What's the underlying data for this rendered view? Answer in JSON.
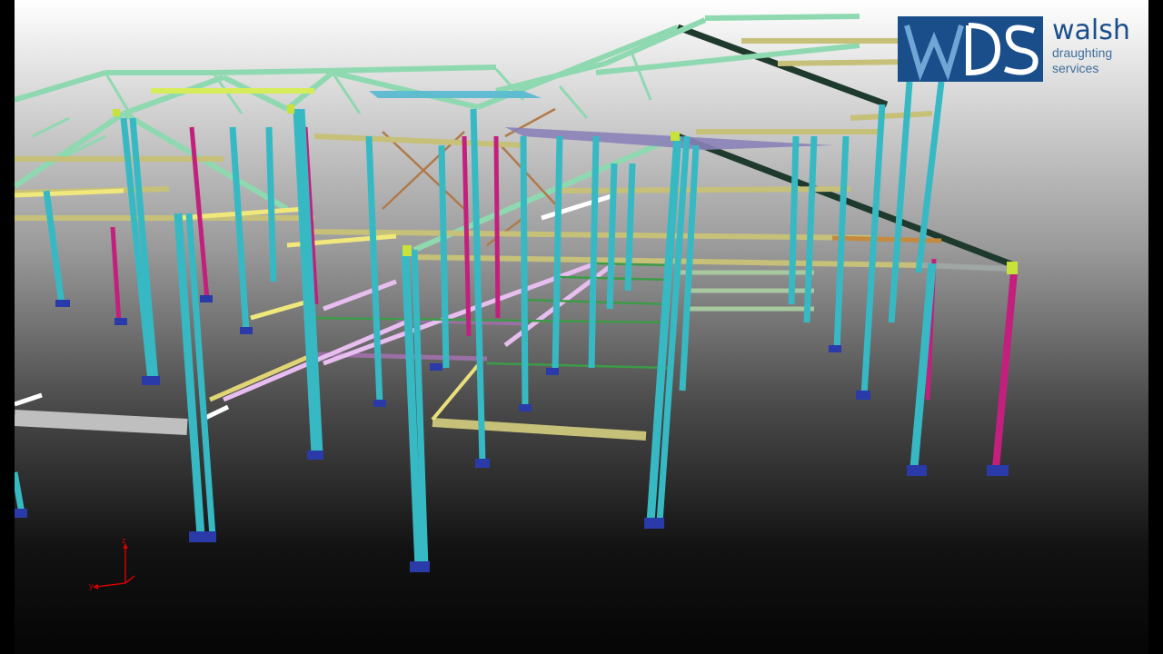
{
  "branding": {
    "logo_mark": "WDS",
    "company_name": "walsh",
    "tagline_line1": "draughting",
    "tagline_line2": "services",
    "primary_color": "#1a4e8a",
    "secondary_color": "#3f6f9d"
  },
  "axis_triad": {
    "z_label": "z",
    "y_label": "y",
    "color": "#d20000"
  },
  "model_colors": {
    "columns": "#37b9c4",
    "rafters": "#8fd9b0",
    "bracing": "#b07a4a",
    "purlins": "#c6c079",
    "secondary_columns": "#c3207d",
    "highlight_beams": "#f1e87c",
    "ties": "#3c9b47",
    "dark_beams": "#1e3a2c"
  }
}
